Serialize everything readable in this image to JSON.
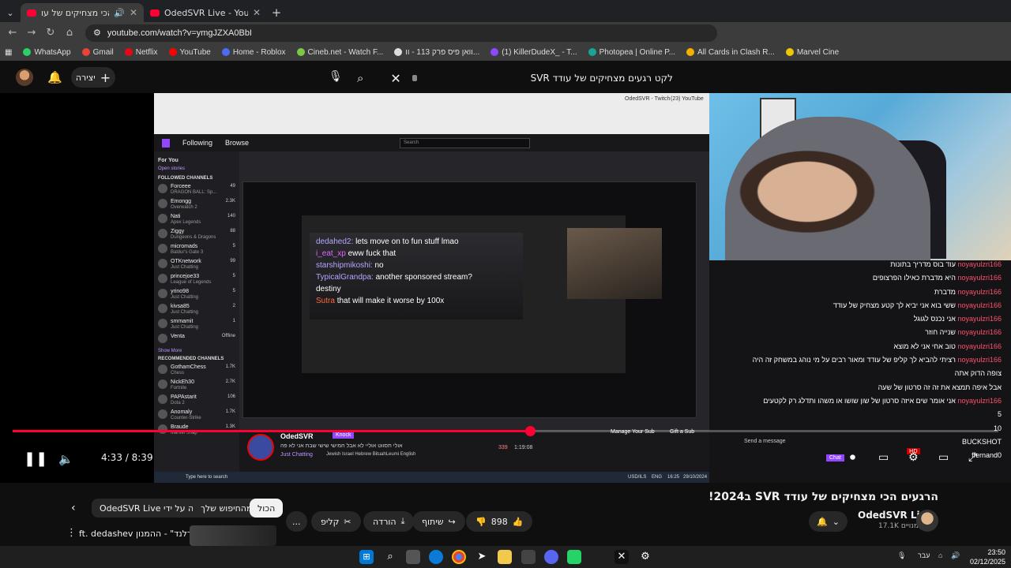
{
  "browser": {
    "tabs": [
      {
        "title": "הרגעים הכי מצחיקים של עו",
        "active": true
      },
      {
        "title": "OdedSVR Live - YouTube",
        "active": false
      }
    ],
    "new_tab": "+",
    "url": "youtube.com/watch?v=ymgJZXA0BbI",
    "bookmarks": [
      "WhatsApp",
      "Gmail",
      "Netflix",
      "YouTube",
      "Home - Roblox",
      "Cineb.net - Watch F...",
      "וואן פיס פרק 113 - וו...",
      "(1) KillerDudeX_ - T...",
      "Photopea | Online P...",
      "All Cards in Clash R...",
      "Marvel Cine"
    ]
  },
  "youtube_header": {
    "create_label": "יצירה",
    "search_query": "לקט רגעים מצחיקים של עודד SVR"
  },
  "inner_stream": {
    "chrome_tabs": [
      "OdedSVR - Twitch",
      "(23) YouTube"
    ],
    "twitch_nav": [
      "Following",
      "Browse"
    ],
    "search_placeholder": "Search",
    "for_you": "For You",
    "open_stories": "Open stories",
    "followed_header": "FOLLOWED CHANNELS",
    "recommended_header": "RECOMMENDED CHANNELS",
    "show_more": "Show More",
    "followed": [
      {
        "name": "Forceee",
        "game": "DRAGON BALL: Sp...",
        "viewers": "49"
      },
      {
        "name": "Emongg",
        "game": "Overwatch 2",
        "viewers": "2.3K"
      },
      {
        "name": "Nati",
        "game": "Apex Legends",
        "viewers": "140"
      },
      {
        "name": "Ziggy",
        "game": "Dungeons & Dragons",
        "viewers": "88"
      },
      {
        "name": "micromads",
        "game": "Baldur's Gate 3",
        "viewers": "5"
      },
      {
        "name": "OTKnetwork",
        "game": "Just Chatting",
        "viewers": "99"
      },
      {
        "name": "princejoe33",
        "game": "League of Legends",
        "viewers": "5"
      },
      {
        "name": "yrino98",
        "game": "Just Chatting",
        "viewers": "5"
      },
      {
        "name": "kivsa85",
        "game": "Just Chatting",
        "viewers": "2"
      },
      {
        "name": "smmamit",
        "game": "Just Chatting",
        "viewers": "1"
      },
      {
        "name": "Venta",
        "game": "",
        "viewers": "Offline"
      }
    ],
    "recommended": [
      {
        "name": "GothamChess",
        "game": "Chess",
        "viewers": "1.7K"
      },
      {
        "name": "NickEh30",
        "game": "Fortnite",
        "viewers": "2.7K"
      },
      {
        "name": "PAPAstarit",
        "game": "Dota 2",
        "viewers": "106"
      },
      {
        "name": "Anomaly",
        "game": "Counter-Strike",
        "viewers": "1.7K"
      },
      {
        "name": "Braude",
        "game": "Marvel Snap",
        "viewers": "1.3K"
      }
    ],
    "chat_lines": [
      {
        "user": "dedahed2:",
        "text": "lets move on to fun stuff lmao"
      },
      {
        "user": "i_eat_xp",
        "text": "eww fuck that"
      },
      {
        "user": "starshipmikoshi:",
        "text": "no"
      },
      {
        "user": "TypicalGrandpa:",
        "text": "another sponsored stream?"
      },
      {
        "user": "",
        "text": "destiny"
      },
      {
        "user": "Sutra",
        "text": "that will make it worse by 100x"
      }
    ],
    "streamer": "OdedSVR",
    "knock": "Knock",
    "stream_title": "אולי תסווט אוליי לא אבל חמישי שישי שבת אני לא פה",
    "category": "Just Chatting",
    "tags": "Jewish  Israel  Hebrew  BituahLeumi  English",
    "viewers": "339",
    "uptime": "1:19:08",
    "manage_sub": "Manage Your Sub",
    "gift_sub": "Gift a Sub",
    "send_message": "Send a message",
    "chat_button": "Chat",
    "taskbar_search": "Type here to search",
    "taskbar_time": "16:25",
    "taskbar_date": "29/10/2024",
    "currency": "USD/ILS",
    "lang": "ENG"
  },
  "overlay_chat": [
    {
      "nick": "noyayulzri166",
      "text": "עוד בוס מדריך בתונות"
    },
    {
      "nick": "noyayulzri166",
      "text": "היא מדברת כאילו הפרצופים"
    },
    {
      "nick": "noyayulzri166",
      "text": "מדברת"
    },
    {
      "nick": "noyayulzri166",
      "text": "ששי בוא אני יביא לך קטע מצחיק של עודד"
    },
    {
      "nick": "noyayulzri166",
      "text": "אני נכנס לגוגל"
    },
    {
      "nick": "noyayulzri166",
      "text": "שנייה חוזר"
    },
    {
      "nick": "noyayulzri166",
      "text": "טוב אחי אני לא מוצא"
    },
    {
      "nick": "noyayulzri166",
      "text": "רציתי להביא לך קליפ של עודד ומאור רבים על מי נוהג במשחק זה היה"
    },
    {
      "nick": "",
      "text": "צופה הדוק אתה"
    },
    {
      "nick": "",
      "text": "אבל איפה תמצא את זה זה סרטון של שעה"
    },
    {
      "nick": "noyayulzri166",
      "text": "אני אומר שים איזה סרטון של שון שושו או משהו ותדלג רק לקטעים"
    },
    {
      "nick": "",
      "text": "5"
    },
    {
      "nick": "",
      "text": "10"
    },
    {
      "nick": "",
      "text": "BUCKSHOT"
    },
    {
      "nick": "",
      "text": "ffernand0"
    }
  ],
  "player": {
    "current_time": "4:33",
    "duration": "8:39",
    "time_separator": " / ",
    "progress": 0.5246,
    "hd_badge": "HD"
  },
  "below": {
    "chips": [
      "הכול",
      "מהחיפוש שלך",
      "הועלה על ידי OdedSVR Live"
    ],
    "title": "הרגעים הכי מצחיקים של עודד SVR ב2024!",
    "channel": "OdedSVR Live",
    "subscribers": "17.1K מנויים",
    "likes": "898",
    "share": "שיתוף",
    "download": "הורדה",
    "clip": "קליפ",
    "more": "...",
    "recommended_title": "\"הסברלנד\" - ההמנון ft. dedashev"
  },
  "os_taskbar": {
    "lang": "עבר",
    "time": "23:50",
    "date": "02/12/2025"
  }
}
